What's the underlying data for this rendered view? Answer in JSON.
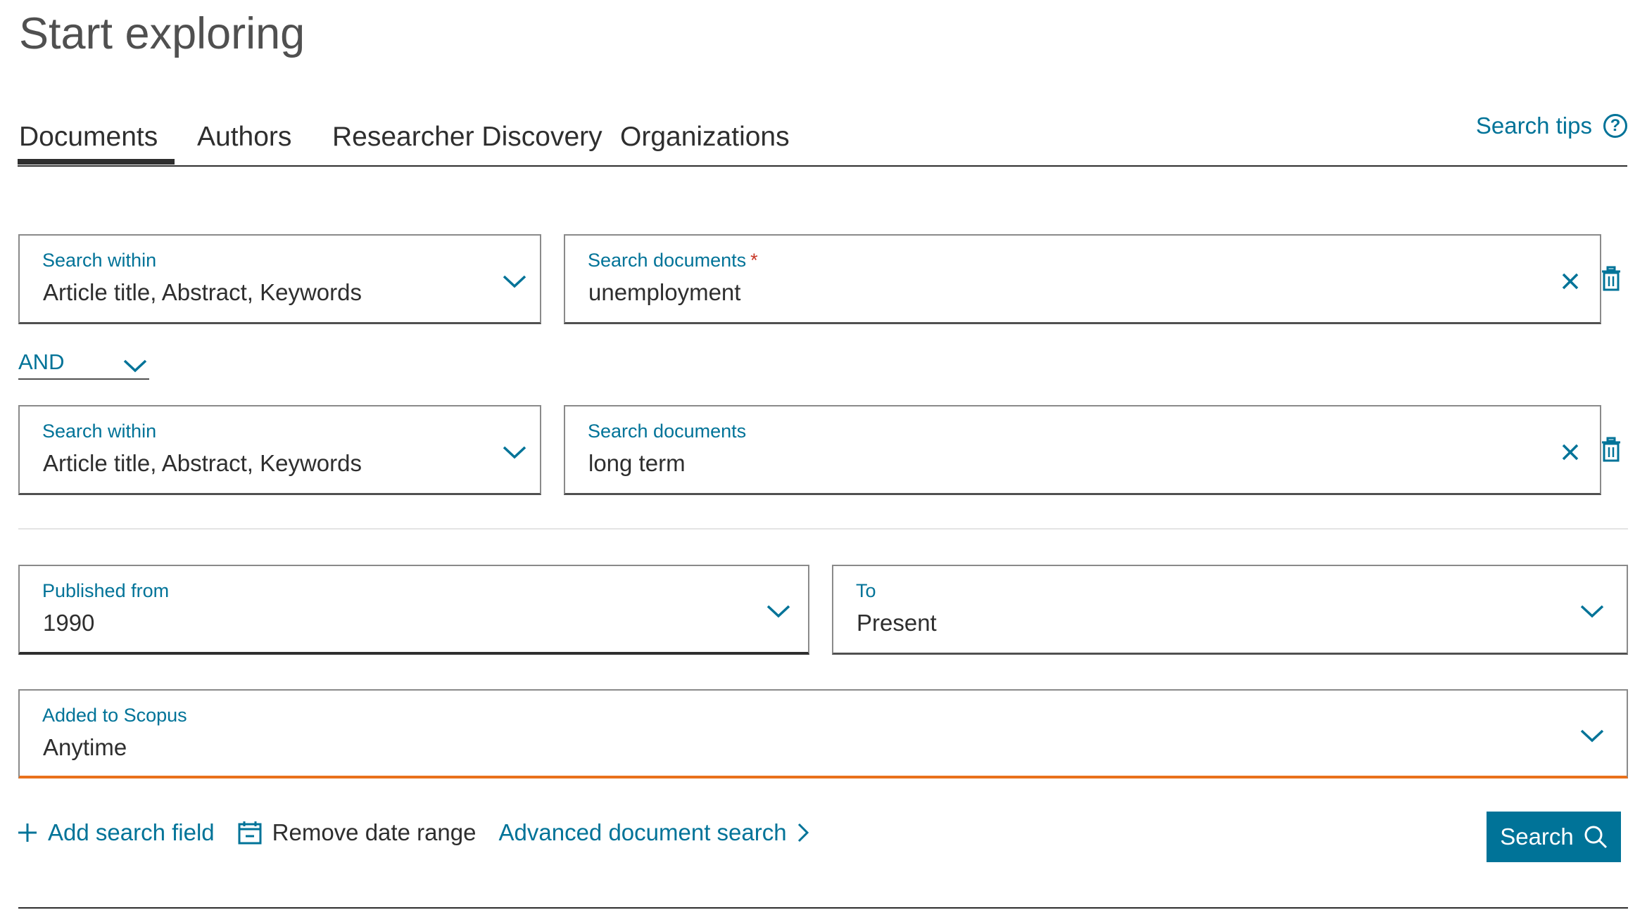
{
  "page": {
    "title": "Start exploring"
  },
  "tabs": [
    {
      "label": "Documents",
      "active": true
    },
    {
      "label": "Authors",
      "active": false
    },
    {
      "label": "Researcher Discovery",
      "active": false
    },
    {
      "label": "Organizations",
      "active": false
    }
  ],
  "search_tips": {
    "label": "Search tips",
    "icon": "help-circle-icon"
  },
  "rows": [
    {
      "within_label": "Search within",
      "within_value": "Article title, Abstract, Keywords",
      "query_label": "Search documents",
      "query_required_marker": "*",
      "query_value": "unemployment"
    },
    {
      "within_label": "Search within",
      "within_value": "Article title, Abstract, Keywords",
      "query_label": "Search documents",
      "query_value": "long term"
    }
  ],
  "operator": {
    "value": "AND"
  },
  "date_range": {
    "from_label": "Published from",
    "from_value": "1990",
    "to_label": "To",
    "to_value": "Present"
  },
  "added_to_scopus": {
    "label": "Added to Scopus",
    "value": "Anytime"
  },
  "actions": {
    "add_field": "Add search field",
    "remove_date": "Remove date range",
    "advanced": "Advanced document search",
    "search_button": "Search"
  },
  "colors": {
    "accent": "#007398",
    "required": "#c83727",
    "focus_border": "#e9711c",
    "text": "#2e2e2e"
  }
}
